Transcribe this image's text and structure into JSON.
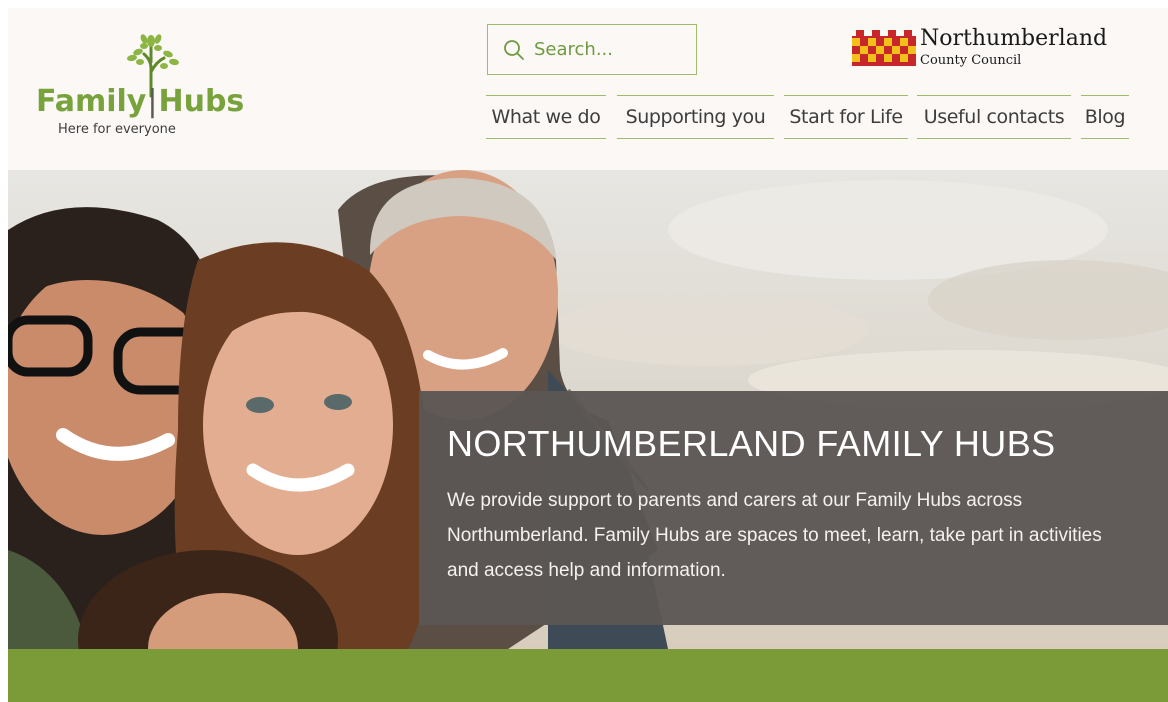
{
  "brand": {
    "logo_word_1": "Family",
    "logo_word_2": "Hubs",
    "tagline": "Here for everyone",
    "primary_color": "#7b9a38"
  },
  "search": {
    "placeholder": "Search...",
    "value": ""
  },
  "council": {
    "name": "Northumberland",
    "subname": "County Council"
  },
  "nav": {
    "items": [
      {
        "label": "What we do"
      },
      {
        "label": "Supporting you"
      },
      {
        "label": "Start for Life"
      },
      {
        "label": "Useful contacts"
      },
      {
        "label": "Blog"
      }
    ]
  },
  "hero": {
    "title": "NORTHUMBERLAND FAMILY HUBS",
    "body": "We provide support to parents and carers at our Family Hubs across Northumberland. Family Hubs are spaces to meet, learn, take part in activities and access help and information."
  }
}
